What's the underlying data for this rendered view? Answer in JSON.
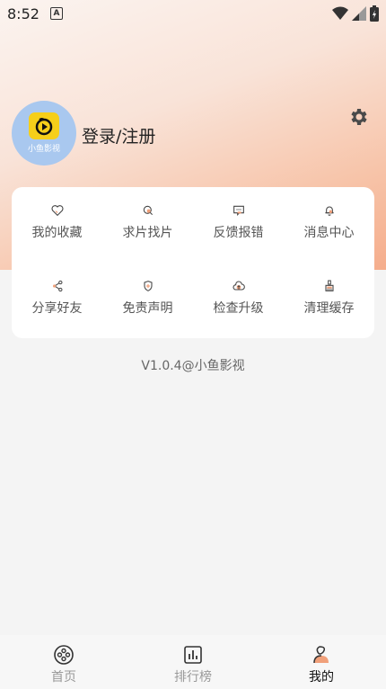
{
  "status": {
    "time": "8:52",
    "notif_icon": "A"
  },
  "profile": {
    "avatar_text": "小鱼影视",
    "login_label": "登录/注册"
  },
  "menu": [
    {
      "label": "我的收藏",
      "icon": "heart-icon"
    },
    {
      "label": "求片找片",
      "icon": "search-icon"
    },
    {
      "label": "反馈报错",
      "icon": "feedback-icon"
    },
    {
      "label": "消息中心",
      "icon": "bell-icon"
    },
    {
      "label": "分享好友",
      "icon": "share-icon"
    },
    {
      "label": "免责声明",
      "icon": "shield-icon"
    },
    {
      "label": "检查升级",
      "icon": "cloud-upload-icon"
    },
    {
      "label": "清理缓存",
      "icon": "broom-icon"
    }
  ],
  "version": "V1.0.4@小鱼影视",
  "tabs": [
    {
      "label": "首页",
      "icon": "film-reel-icon"
    },
    {
      "label": "排行榜",
      "icon": "chart-icon"
    },
    {
      "label": "我的",
      "icon": "user-icon"
    }
  ],
  "colors": {
    "accent": "#f0a07a",
    "avatar_bg": "#a9c8ef",
    "logo": "#f6cf1a"
  }
}
